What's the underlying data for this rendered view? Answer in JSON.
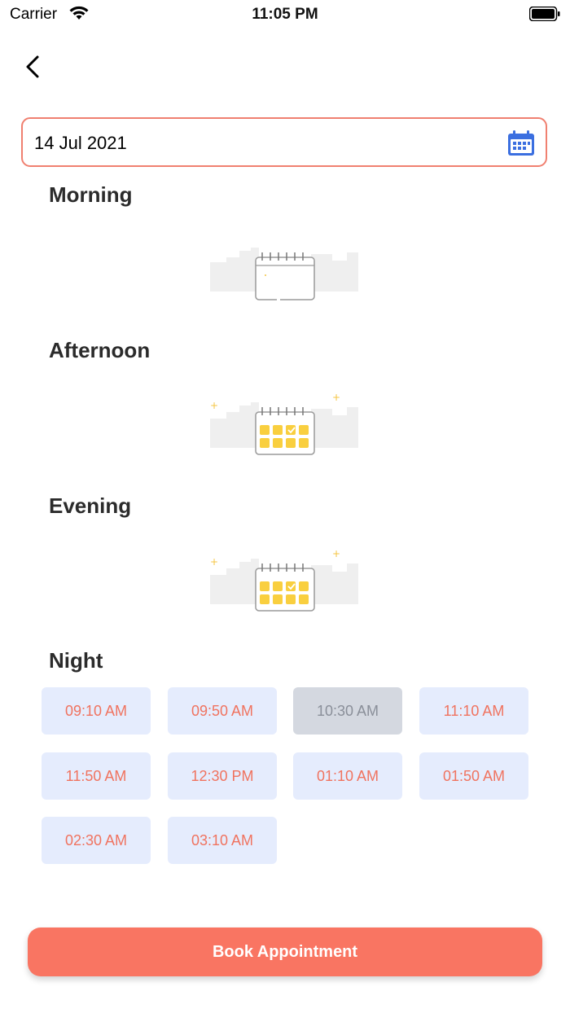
{
  "status_bar": {
    "carrier": "Carrier",
    "time": "11:05 PM"
  },
  "date_field": {
    "value": "14 Jul 2021"
  },
  "sections": {
    "morning": {
      "title": "Morning"
    },
    "afternoon": {
      "title": "Afternoon"
    },
    "evening": {
      "title": "Evening"
    },
    "night": {
      "title": "Night",
      "slots": [
        {
          "label": "09:10 AM",
          "state": "available"
        },
        {
          "label": "09:50 AM",
          "state": "available"
        },
        {
          "label": "10:30 AM",
          "state": "disabled"
        },
        {
          "label": "11:10 AM",
          "state": "available"
        },
        {
          "label": "11:50 AM",
          "state": "available"
        },
        {
          "label": "12:30 PM",
          "state": "available"
        },
        {
          "label": "01:10 AM",
          "state": "available"
        },
        {
          "label": "01:50 AM",
          "state": "available"
        },
        {
          "label": "02:30 AM",
          "state": "available"
        },
        {
          "label": "03:10 AM",
          "state": "available"
        }
      ]
    }
  },
  "book_button": {
    "label": "Book Appointment"
  },
  "colors": {
    "accent": "#f97562",
    "field_border": "#f08070",
    "slot_bg": "#e5ecfd",
    "slot_text": "#f0735f",
    "slot_disabled_bg": "#d4d8e0",
    "calendar_icon": "#3b6fe0"
  },
  "icons": [
    "wifi-icon",
    "battery-icon",
    "back-arrow-icon",
    "calendar-icon",
    "empty-calendar-illustration"
  ]
}
